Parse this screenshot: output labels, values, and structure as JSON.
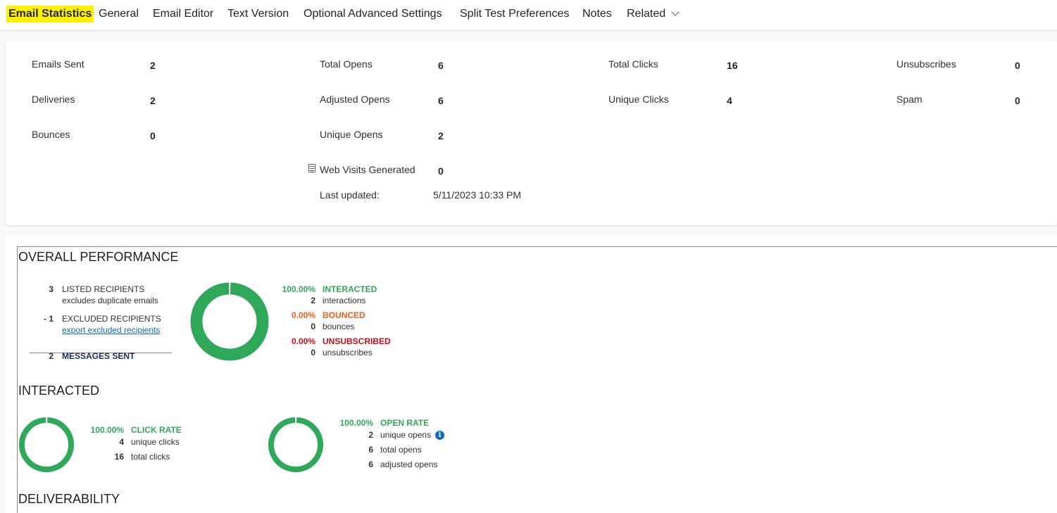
{
  "tabs": [
    {
      "label": "Email Statistics",
      "active": true
    },
    {
      "label": "General"
    },
    {
      "label": "Email Editor"
    },
    {
      "label": "Text Version"
    },
    {
      "label": "Optional Advanced Settings"
    },
    {
      "label": "Split Test Preferences"
    },
    {
      "label": "Notes"
    },
    {
      "label": "Related"
    }
  ],
  "stats": {
    "emails_sent": {
      "label": "Emails Sent",
      "value": "2"
    },
    "deliveries": {
      "label": "Deliveries",
      "value": "2"
    },
    "bounces": {
      "label": "Bounces",
      "value": "0"
    },
    "total_opens": {
      "label": "Total Opens",
      "value": "6"
    },
    "adjusted_opens": {
      "label": "Adjusted Opens",
      "value": "6"
    },
    "unique_opens": {
      "label": "Unique Opens",
      "value": "2"
    },
    "web_visits": {
      "label": "Web Visits Generated",
      "value": "0",
      "icon": "calculator-icon"
    },
    "total_clicks": {
      "label": "Total Clicks",
      "value": "16"
    },
    "unique_clicks": {
      "label": "Unique Clicks",
      "value": "4"
    },
    "unsubscribes": {
      "label": "Unsubscribes",
      "value": "0"
    },
    "spam": {
      "label": "Spam",
      "value": "0"
    },
    "last_updated": {
      "label": "Last updated:",
      "value": "5/11/2023 10:33 PM"
    }
  },
  "overall": {
    "title": "OVERALL PERFORMANCE",
    "listed": {
      "num": "3",
      "label": "LISTED RECIPIENTS",
      "sub": "excludes duplicate emails"
    },
    "excluded": {
      "num": "- 1",
      "label": "EXCLUDED RECIPIENTS",
      "link": "export excluded recipients"
    },
    "sent": {
      "num": "2",
      "label": "MESSAGES SENT"
    },
    "interacted": {
      "pct": "100.00%",
      "label": "INTERACTED",
      "count": "2",
      "unit": "interactions",
      "fraction": 1.0
    },
    "bounced": {
      "pct": "0.00%",
      "label": "BOUNCED",
      "count": "0",
      "unit": "bounces",
      "fraction": 0.0
    },
    "unsubscribed": {
      "pct": "0.00%",
      "label": "UNSUBSCRIBED",
      "count": "0",
      "unit": "unsubscribes",
      "fraction": 0.0
    }
  },
  "interacted": {
    "title": "INTERACTED",
    "click_rate": {
      "pct": "100.00%",
      "label": "CLICK RATE",
      "fraction": 1.0,
      "rows": [
        {
          "num": "4",
          "text": "unique clicks"
        },
        {
          "num": "16",
          "text": "total clicks"
        }
      ]
    },
    "open_rate": {
      "pct": "100.00%",
      "label": "OPEN RATE",
      "fraction": 1.0,
      "rows": [
        {
          "num": "2",
          "text": "unique opens"
        },
        {
          "num": "6",
          "text": "total opens"
        },
        {
          "num": "6",
          "text": "adjusted opens"
        }
      ]
    }
  },
  "deliverability": {
    "title": "DELIVERABILITY"
  },
  "colors": {
    "green": "#2fa85a",
    "orange": "#e8601c",
    "red": "#c50f1f",
    "highlight": "#fff200",
    "link": "#0f6cbd"
  }
}
